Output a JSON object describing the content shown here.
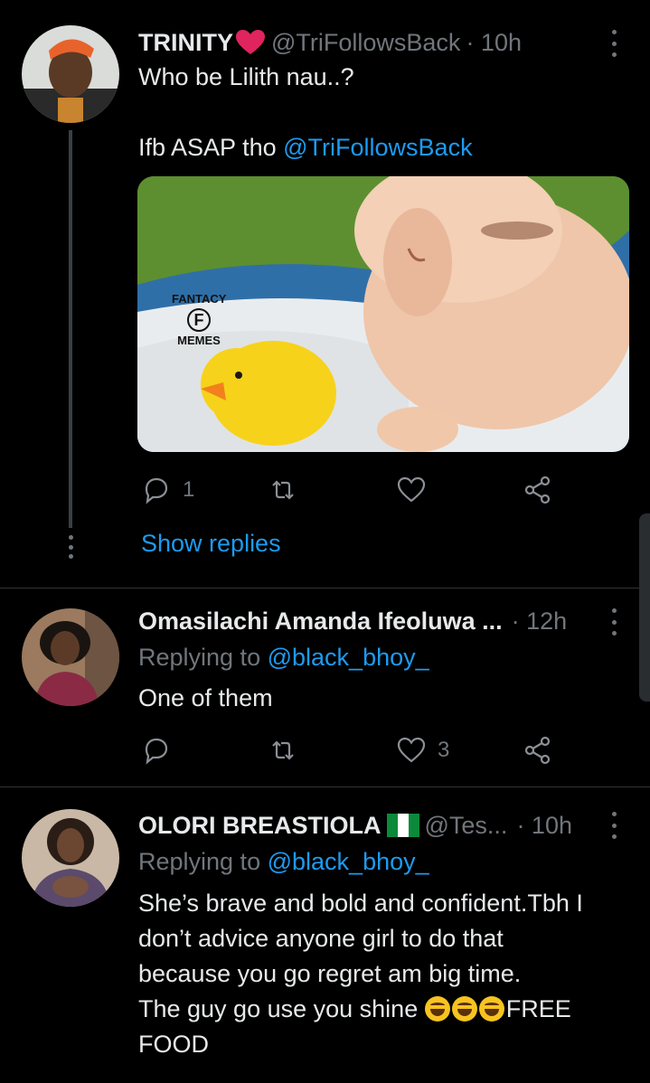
{
  "tweets": [
    {
      "name": "TRINITY",
      "handle": "@TriFollowsBack",
      "time": "· 10h",
      "text_line1": "Who be Lilith nau..?",
      "text_line2": "Ifb ASAP tho",
      "text_mention": "@TriFollowsBack",
      "media_watermark": {
        "top": "FANTACY",
        "mid": "F",
        "bottom": "MEMES"
      },
      "reply_count": "1",
      "retweet_count": "",
      "like_count": "",
      "show_replies": "Show replies"
    },
    {
      "name": "Omasilachi Amanda Ifeoluwa ...",
      "time": "· 12h",
      "replying_prefix": "Replying to",
      "replying_to": "@black_bhoy_",
      "text": "One of them",
      "reply_count": "",
      "retweet_count": "",
      "like_count": "3"
    },
    {
      "name": "OLORI BREASTIOLA",
      "handle": "@Tes...",
      "time": "· 10h",
      "replying_prefix": "Replying to",
      "replying_to": "@black_bhoy_",
      "text_lines": [
        "She’s brave and bold and confident.Tbh I",
        "don’t advice anyone girl to do that",
        "because you go regret am big time.",
        "The guy go use you shine "
      ],
      "text_tail": "FREE",
      "text_last": "FOOD"
    }
  ],
  "colors": {
    "accent": "#1d9bf0",
    "muted": "#71767b",
    "heart": "#e0245e",
    "background": "#000000"
  },
  "icons": [
    "reply-icon",
    "retweet-icon",
    "like-icon",
    "share-icon",
    "more-icon",
    "heart-emoji",
    "nigeria-flag-emoji",
    "rofl-emoji"
  ]
}
